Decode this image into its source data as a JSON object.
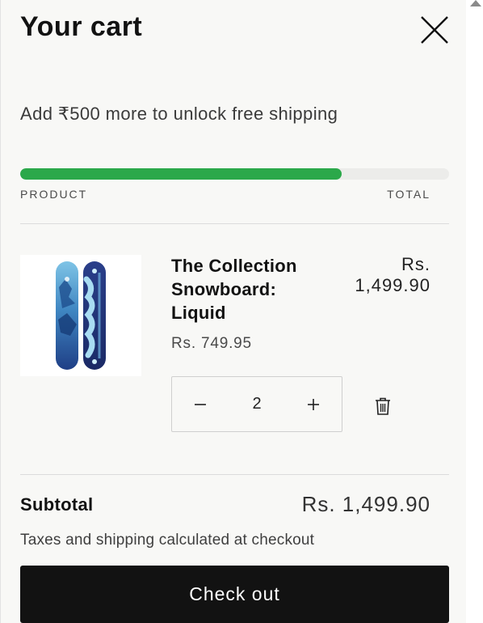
{
  "header": {
    "title": "Your cart",
    "close_icon": "close-icon"
  },
  "shipping": {
    "message": "Add ₹500 more to unlock free shipping",
    "progress": 0.75,
    "progress_color": "#2ba84a"
  },
  "table_headers": {
    "product": "PRODUCT",
    "total": "TOTAL"
  },
  "items": [
    {
      "name": "The Collection Snowboard: Liquid",
      "unit_price": "Rs. 749.95",
      "line_total": "Rs. 1,499.90",
      "quantity": "2",
      "image_icon": "snowboard-image",
      "decrease_icon": "minus-icon",
      "increase_icon": "plus-icon",
      "remove_icon": "trash-icon"
    }
  ],
  "footer": {
    "subtotal_label": "Subtotal",
    "subtotal_value": "Rs. 1,499.90",
    "tax_note": "Taxes and shipping calculated at checkout",
    "checkout_label": "Check out"
  }
}
